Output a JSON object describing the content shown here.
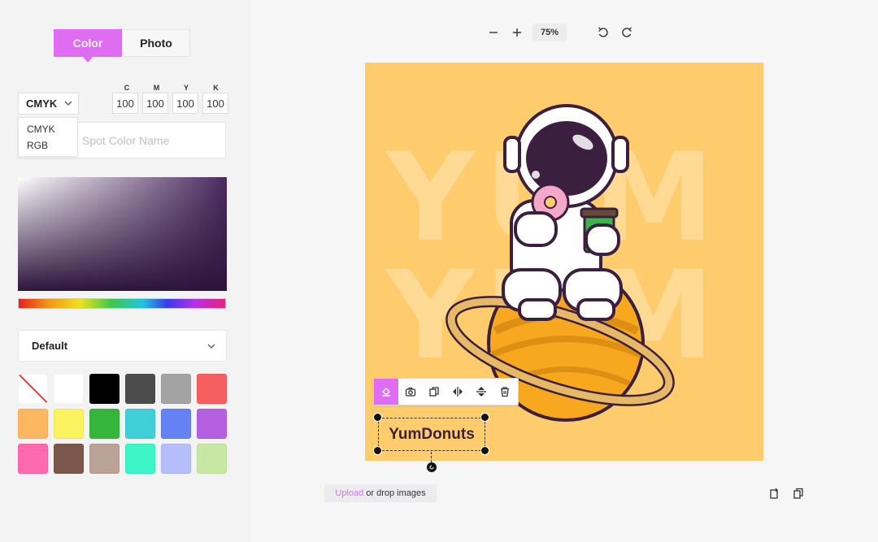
{
  "mode_tabs": {
    "color": "Color",
    "photo": "Photo"
  },
  "cmyk": {
    "labels": [
      "C",
      "M",
      "Y",
      "K"
    ],
    "values": [
      "100",
      "100",
      "100",
      "100"
    ]
  },
  "color_model": {
    "selected": "CMYK",
    "options": [
      "CMYK",
      "RGB"
    ]
  },
  "spot_color": {
    "placeholder": "Spot Color Name"
  },
  "palette": {
    "selected": "Default",
    "swatches": [
      "none",
      "#ffffff",
      "#000000",
      "#4c4c4c",
      "#a3a3a3",
      "#f55f5f",
      "#fdb761",
      "#fbf260",
      "#36b53d",
      "#3fcfd6",
      "#6582f4",
      "#b560e0",
      "#ff69ad",
      "#7a574a",
      "#bba297",
      "#3ef5c8",
      "#b5bdfb",
      "#c7e7a5"
    ]
  },
  "toolbar": {
    "zoom_level": "75%"
  },
  "canvas": {
    "background_color": "#fecc6c",
    "bg_text_line1": "YUM",
    "bg_text_line2": "YUM",
    "selected_text": "YumDonuts"
  },
  "object_toolbar": {
    "tools": [
      "fill-icon",
      "camera-icon",
      "duplicate-icon",
      "flip-horizontal-icon",
      "flip-vertical-icon",
      "trash-icon"
    ]
  },
  "upload": {
    "link_text": "Upload",
    "rest_text": "or drop images"
  },
  "accent_color": "#e06cf4"
}
